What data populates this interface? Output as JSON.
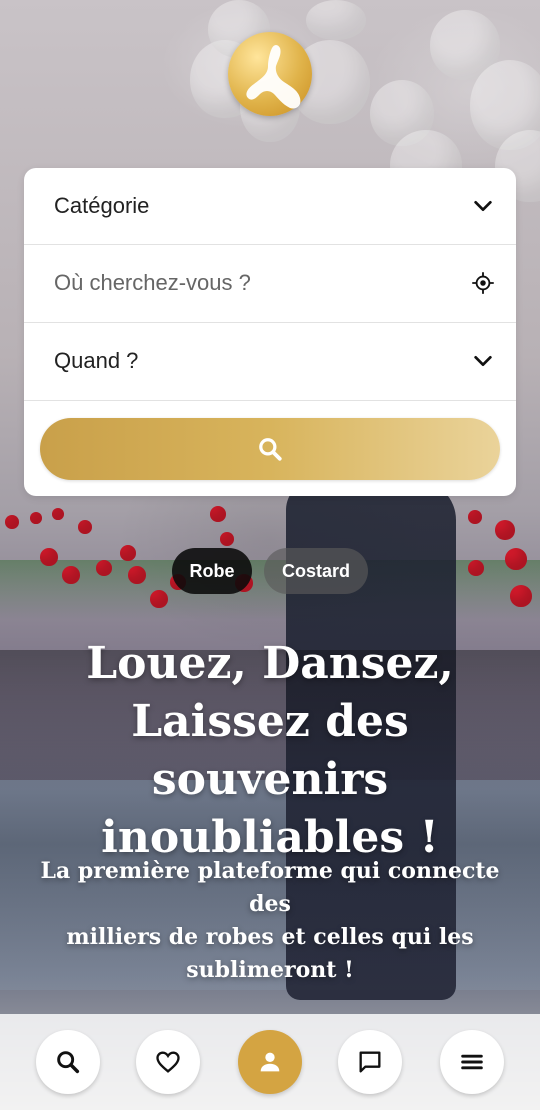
{
  "search_card": {
    "category_label": "Catégorie",
    "location_placeholder": "Où cherchez-vous ?",
    "when_label": "Quand ?"
  },
  "chips": [
    {
      "label": "Robe",
      "selected": true
    },
    {
      "label": "Costard",
      "selected": false
    }
  ],
  "hero": {
    "headline_lines": [
      "Louez, Dansez,",
      "Laissez des souvenirs",
      "inoubliables !"
    ],
    "subline_lines": [
      "La première plateforme qui connecte des",
      "milliers de robes et celles qui les",
      "sublimeront !"
    ]
  },
  "bottom_nav": {
    "items": [
      {
        "name": "search",
        "icon": "search-icon"
      },
      {
        "name": "favorites",
        "icon": "heart-icon"
      },
      {
        "name": "profile",
        "icon": "user-icon",
        "active": true
      },
      {
        "name": "messages",
        "icon": "chat-icon"
      },
      {
        "name": "menu",
        "icon": "hamburger-menu-icon"
      }
    ]
  },
  "colors": {
    "accent_gold": "#d4a442",
    "gradient_start": "#c9a04a",
    "gradient_end": "#ead39a"
  }
}
